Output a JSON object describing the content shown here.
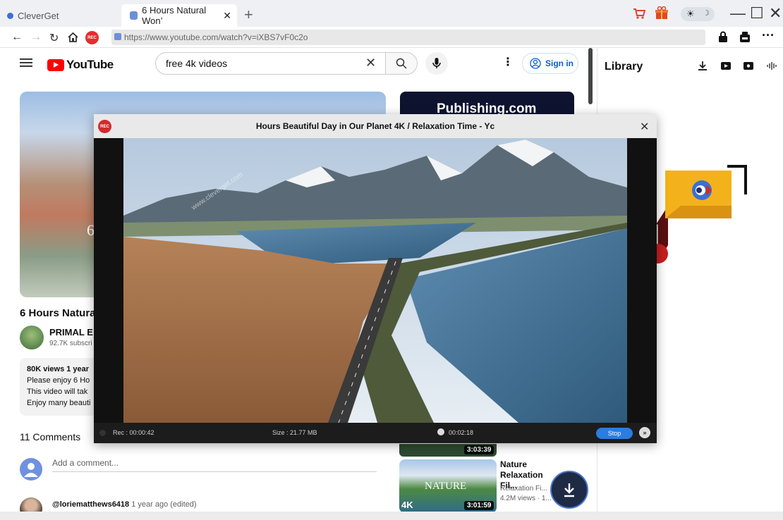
{
  "tabs": [
    {
      "label": "CleverGet"
    },
    {
      "label": "6 Hours Natural Won’"
    }
  ],
  "new_tab": "+",
  "address_bar": {
    "url": "https://www.youtube.com/watch?v=iXBS7vF0c2o",
    "rec_label": "REC"
  },
  "youtube": {
    "logo_text": "YouTube",
    "search_value": "free 4k videos",
    "sign_in": "Sign in",
    "hero_text": "6 H",
    "ad_text": "Publishing.com",
    "video_title": "6 Hours Natura",
    "channel_name": "PRIMAL E",
    "subscribers": "92.7K subscri",
    "description": {
      "stats": "80K views  1 year",
      "lines": [
        "Please enjoy 6 Ho",
        "This video will tak",
        "Enjoy many beauti"
      ]
    },
    "comments_count": "11 Comments",
    "add_comment_placeholder": "Add a comment...",
    "comment": {
      "author": "@loriematthews6418",
      "meta": "1 year ago (edited)"
    },
    "recommended": [
      {
        "duration": "3:03:39"
      },
      {
        "duration": "3:01:59",
        "badge": "4K",
        "thumb_text": "NATURE",
        "title": "Nature Relaxation Fil...",
        "channel": "Relaxation Fi...",
        "meta": "4.2M views · 1..."
      }
    ]
  },
  "library": {
    "title": "Library"
  },
  "recorder": {
    "logo": "REC",
    "title": "Hours Beautiful Day in Our Planet 4K / Relaxation Time - Yc",
    "watermark": "www.cleverget.com",
    "rec_time": "Rec : 00:00:42",
    "size": "Size : 21.77 MB",
    "timer": "00:02:18",
    "stop_label": "Stop"
  },
  "colors": {
    "accent": "#2a7de1",
    "rec_red": "#e22d2d",
    "youtube_red": "#ff0000",
    "link_blue": "#065fd4"
  }
}
